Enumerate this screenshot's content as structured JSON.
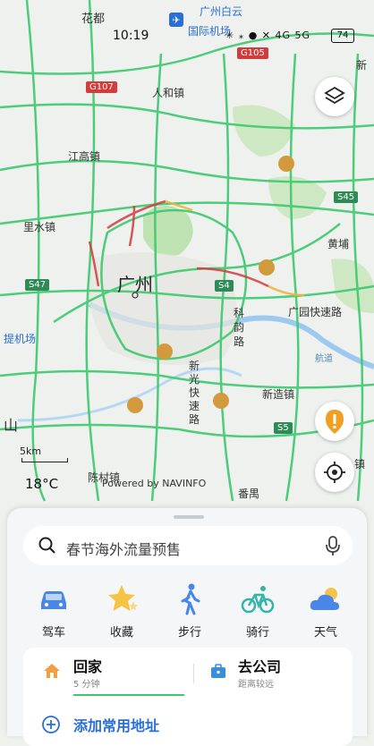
{
  "status": {
    "time": "10:19",
    "battery": "74",
    "icons": "✳ ⁎ ● ✕ 4G 5G"
  },
  "map": {
    "labels": {
      "huadu": "花都",
      "airport_top": "广州白云",
      "airport_bottom": "国际机场",
      "renhe": "人和镇",
      "jianggao": "江高镇",
      "lishui": "里水镇",
      "guangzhou": "广州",
      "huangpu": "黄埔",
      "guangyuan": "广园快速路",
      "kejun": "科\n韵\n路",
      "xinguang": "新\n光\n快\n速\n路",
      "xinzao": "新造镇",
      "chencun": "陈村镇",
      "panyu": "番禺",
      "shan": "山",
      "xin_right": "新",
      "zhen_right": "镇",
      "jichang_left": "提机场",
      "heyi": "航道"
    },
    "highways": {
      "g105": "G105",
      "g107": "G107",
      "s45": "S45",
      "s47": "S47",
      "s4": "S4",
      "s5": "S5"
    }
  },
  "overlay": {
    "scale": "5km",
    "weather_temp": "18°C",
    "powered_by": "Powered by NAVINFO"
  },
  "search": {
    "placeholder": "春节海外流量预售"
  },
  "quick_actions": [
    {
      "label": "驾车",
      "icon": "car-icon"
    },
    {
      "label": "收藏",
      "icon": "star-icon"
    },
    {
      "label": "步行",
      "icon": "walk-icon"
    },
    {
      "label": "骑行",
      "icon": "bike-icon"
    },
    {
      "label": "天气",
      "icon": "weather-icon"
    }
  ],
  "destinations": {
    "home": {
      "title": "回家",
      "sub": "5 分钟"
    },
    "work": {
      "title": "去公司",
      "sub": "距离较远"
    },
    "add": "添加常用地址"
  },
  "colors": {
    "road": "#3cc86e",
    "congestion": "#d23c3c",
    "accent": "#2a6fd6",
    "home": "#f0a040"
  }
}
